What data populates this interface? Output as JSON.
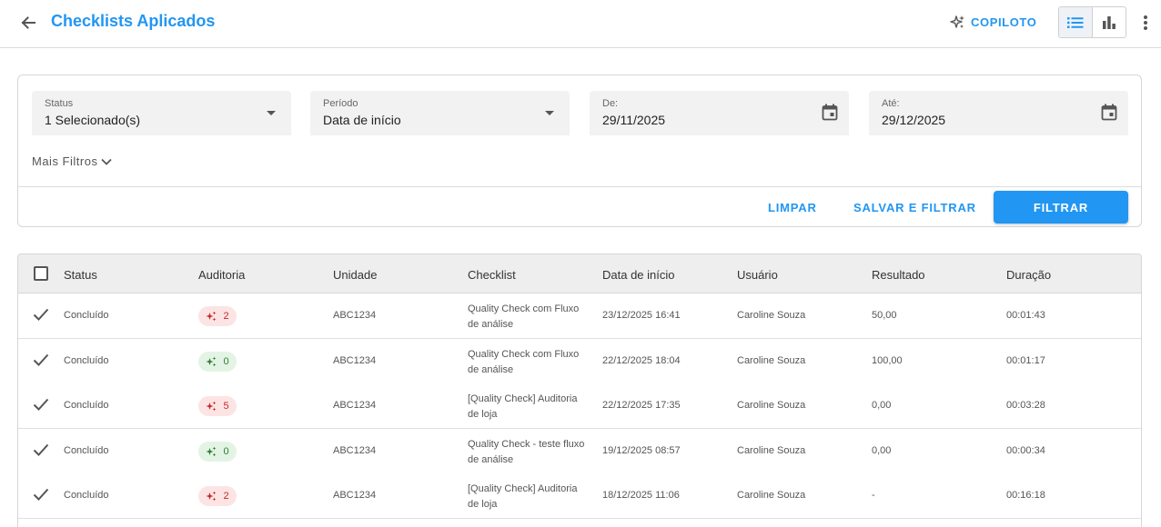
{
  "header": {
    "title": "Checklists Aplicados",
    "copilot_label": "COPILOTO"
  },
  "filters": {
    "status": {
      "label": "Status",
      "value": "1 Selecionado(s)"
    },
    "periodo": {
      "label": "Período",
      "value": "Data de início"
    },
    "de": {
      "label": "De:",
      "value": "29/11/2025"
    },
    "ate": {
      "label": "Até:",
      "value": "29/12/2025"
    },
    "more_label": "Mais Filtros",
    "clear_label": "LIMPAR",
    "save_filter_label": "SALVAR E FILTRAR",
    "filter_label": "FILTRAR"
  },
  "table": {
    "columns": {
      "status": "Status",
      "auditoria": "Auditoria",
      "unidade": "Unidade",
      "checklist": "Checklist",
      "data_inicio": "Data de início",
      "usuario": "Usuário",
      "resultado": "Resultado",
      "duracao": "Duração"
    },
    "rows": [
      {
        "status": "Concluído",
        "auditoria": "2",
        "auditoria_color": "#c62828",
        "unidade": "ABC1234",
        "checklist": "Quality Check com Fluxo de análise",
        "data_inicio": "23/12/2025 16:41",
        "usuario": "Caroline Souza",
        "resultado": "50,00",
        "duracao": "00:01:43"
      },
      {
        "status": "Concluído",
        "auditoria": "0",
        "auditoria_color": "#2e7d32",
        "unidade": "ABC1234",
        "checklist": "Quality Check com Fluxo de análise",
        "data_inicio": "22/12/2025 18:04",
        "usuario": "Caroline Souza",
        "resultado": "100,00",
        "duracao": "00:01:17"
      },
      {
        "status": "Concluído",
        "auditoria": "5",
        "auditoria_color": "#c62828",
        "unidade": "ABC1234",
        "checklist": "[Quality Check] Auditoria de loja",
        "data_inicio": "22/12/2025 17:35",
        "usuario": "Caroline Souza",
        "resultado": "0,00",
        "duracao": "00:03:28"
      },
      {
        "status": "Concluído",
        "auditoria": "0",
        "auditoria_color": "#2e7d32",
        "unidade": "ABC1234",
        "checklist": "Quality Check - teste fluxo de análise",
        "data_inicio": "19/12/2025 08:57",
        "usuario": "Caroline Souza",
        "resultado": "0,00",
        "duracao": "00:00:34"
      },
      {
        "status": "Concluído",
        "auditoria": "2",
        "auditoria_color": "#c62828",
        "unidade": "ABC1234",
        "checklist": "[Quality Check] Auditoria de loja",
        "data_inicio": "18/12/2025 11:06",
        "usuario": "Caroline Souza",
        "resultado": "-",
        "duracao": "00:16:18"
      }
    ]
  },
  "colors": {
    "accent": "#2196f3",
    "badge_red_bg": "#fce4e4",
    "badge_green_bg": "#e3f4e5"
  },
  "icons": {
    "back": "arrow-left-icon",
    "copilot": "sparkles-icon",
    "list_view": "list-icon",
    "chart_view": "bar-chart-icon",
    "more": "more-vertical-icon",
    "calendar": "calendar-icon",
    "row_status": "check-icon",
    "audit": "sparkles-icon"
  }
}
